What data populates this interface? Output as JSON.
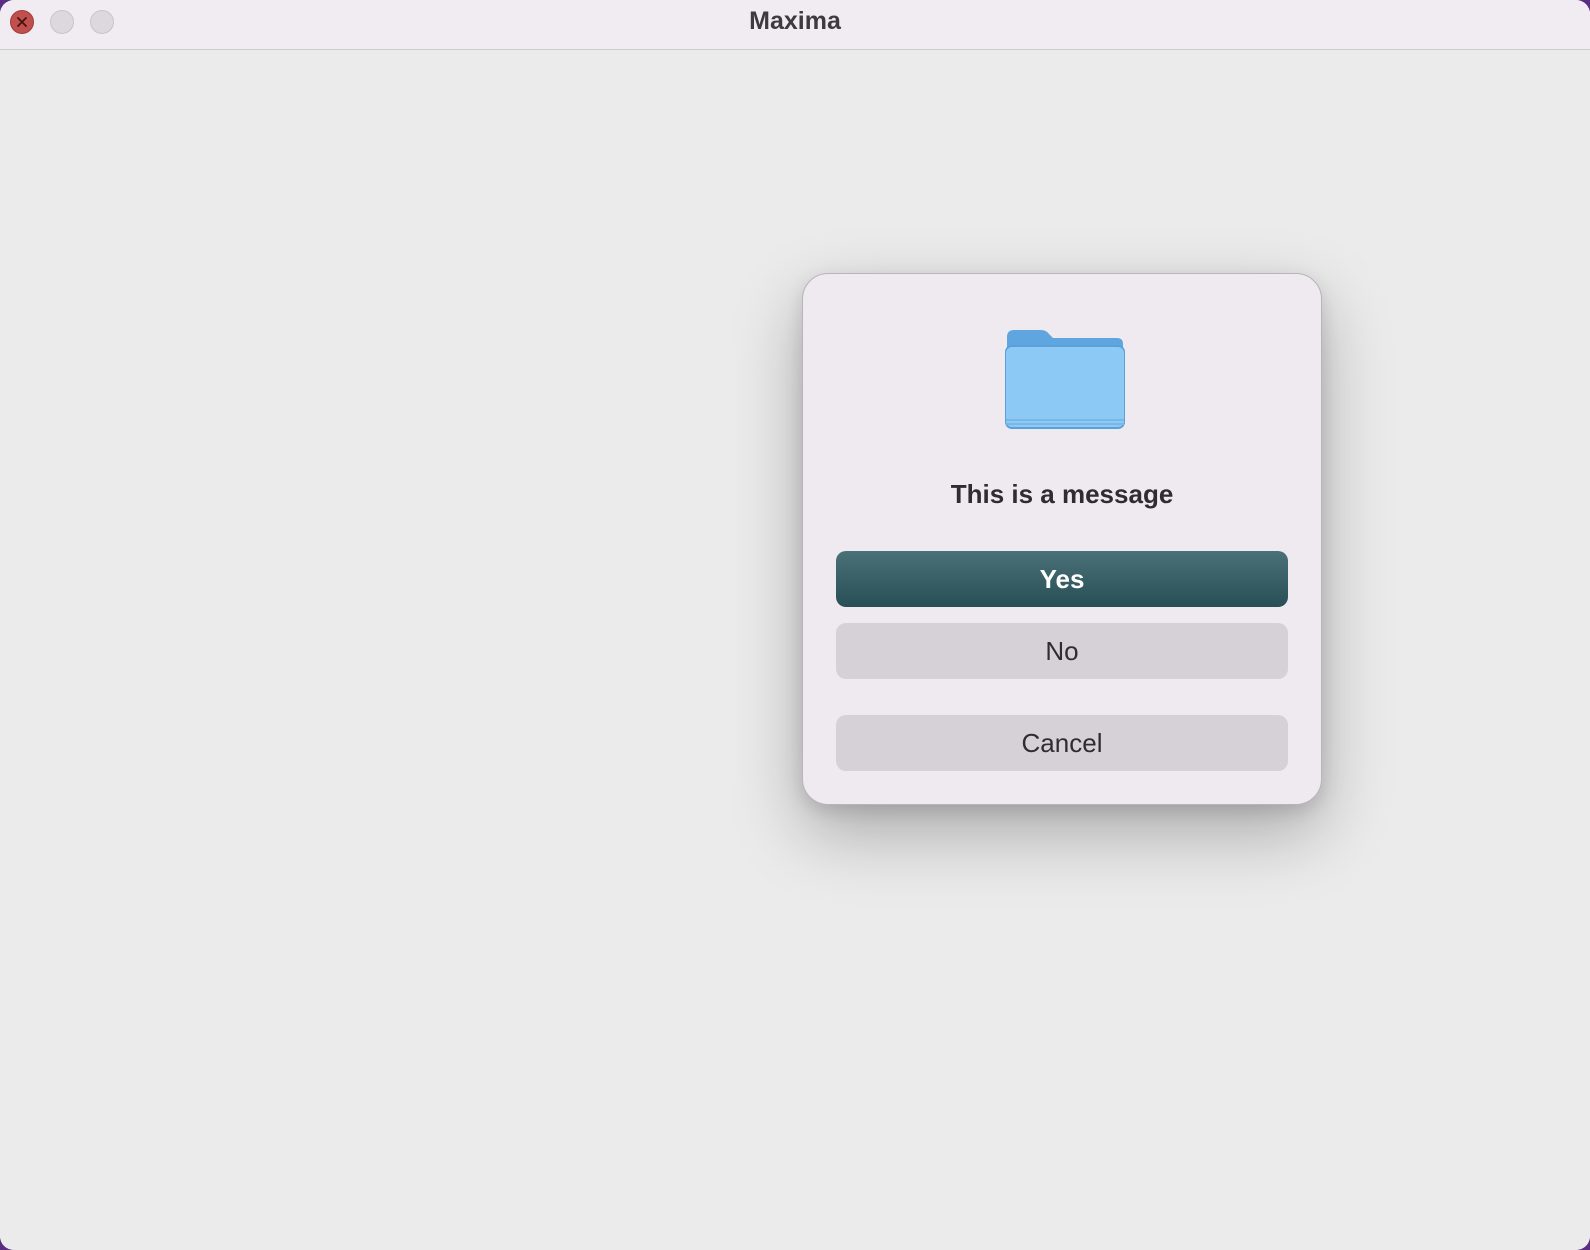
{
  "window": {
    "title": "Maxima",
    "controls": {
      "close_icon": "close-icon",
      "minimize_icon": "minimize-icon",
      "zoom_icon": "zoom-icon"
    }
  },
  "dialog": {
    "icon": "folder-icon",
    "message": "This is a message",
    "buttons": {
      "yes": "Yes",
      "no": "No",
      "cancel": "Cancel"
    }
  },
  "colors": {
    "default_button": "#2f555c",
    "secondary_button": "#d6d0d7",
    "close_button": "#c0504d",
    "folder": "#8ccaf5"
  }
}
